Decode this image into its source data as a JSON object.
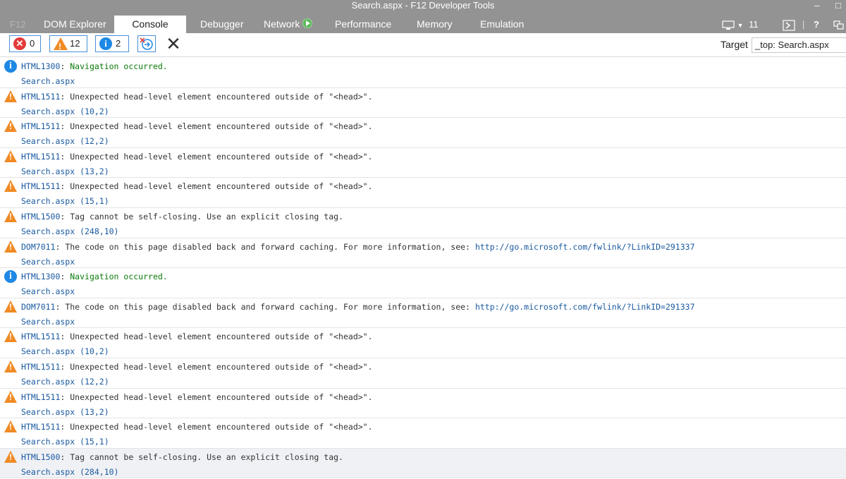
{
  "window": {
    "title": "Search.aspx - F12 Developer Tools",
    "minimize_label": "–",
    "maximize_label": "□"
  },
  "tabs": {
    "f12": "F12",
    "dom_explorer": "DOM Explorer",
    "console": "Console",
    "debugger": "Debugger",
    "network": "Network",
    "performance": "Performance",
    "memory": "Memory",
    "emulation": "Emulation"
  },
  "right_tools": {
    "browser_version": "11",
    "help": "?"
  },
  "toolbar": {
    "errors_count": "0",
    "warnings_count": "12",
    "info_count": "2",
    "clear_label": "✕",
    "target_label": "Target",
    "target_value": "_top: Search.aspx"
  },
  "entries": [
    {
      "type": "info",
      "code": "HTML1300",
      "text": "Navigation occurred.",
      "link": "",
      "source": "Search.aspx"
    },
    {
      "type": "warn",
      "code": "HTML1511",
      "text": "Unexpected head-level element encountered outside of \"<head>\".",
      "link": "",
      "source": "Search.aspx (10,2)"
    },
    {
      "type": "warn",
      "code": "HTML1511",
      "text": "Unexpected head-level element encountered outside of \"<head>\".",
      "link": "",
      "source": "Search.aspx (12,2)"
    },
    {
      "type": "warn",
      "code": "HTML1511",
      "text": "Unexpected head-level element encountered outside of \"<head>\".",
      "link": "",
      "source": "Search.aspx (13,2)"
    },
    {
      "type": "warn",
      "code": "HTML1511",
      "text": "Unexpected head-level element encountered outside of \"<head>\".",
      "link": "",
      "source": "Search.aspx (15,1)"
    },
    {
      "type": "warn",
      "code": "HTML1500",
      "text": "Tag cannot be self-closing. Use an explicit closing tag.",
      "link": "",
      "source": "Search.aspx (248,10)"
    },
    {
      "type": "warn",
      "code": "DOM7011",
      "text": "The code on this page disabled back and forward caching. For more information, see:",
      "link": "http://go.microsoft.com/fwlink/?LinkID=291337",
      "source": "Search.aspx"
    },
    {
      "type": "info",
      "code": "HTML1300",
      "text": "Navigation occurred.",
      "link": "",
      "source": "Search.aspx"
    },
    {
      "type": "warn",
      "code": "DOM7011",
      "text": "The code on this page disabled back and forward caching. For more information, see:",
      "link": "http://go.microsoft.com/fwlink/?LinkID=291337",
      "source": "Search.aspx"
    },
    {
      "type": "warn",
      "code": "HTML1511",
      "text": "Unexpected head-level element encountered outside of \"<head>\".",
      "link": "",
      "source": "Search.aspx (10,2)"
    },
    {
      "type": "warn",
      "code": "HTML1511",
      "text": "Unexpected head-level element encountered outside of \"<head>\".",
      "link": "",
      "source": "Search.aspx (12,2)"
    },
    {
      "type": "warn",
      "code": "HTML1511",
      "text": "Unexpected head-level element encountered outside of \"<head>\".",
      "link": "",
      "source": "Search.aspx (13,2)"
    },
    {
      "type": "warn",
      "code": "HTML1511",
      "text": "Unexpected head-level element encountered outside of \"<head>\".",
      "link": "",
      "source": "Search.aspx (15,1)"
    },
    {
      "type": "warn",
      "code": "HTML1500",
      "text": "Tag cannot be self-closing. Use an explicit closing tag.",
      "link": "",
      "source": "Search.aspx (284,10)",
      "highlight": true
    }
  ]
}
